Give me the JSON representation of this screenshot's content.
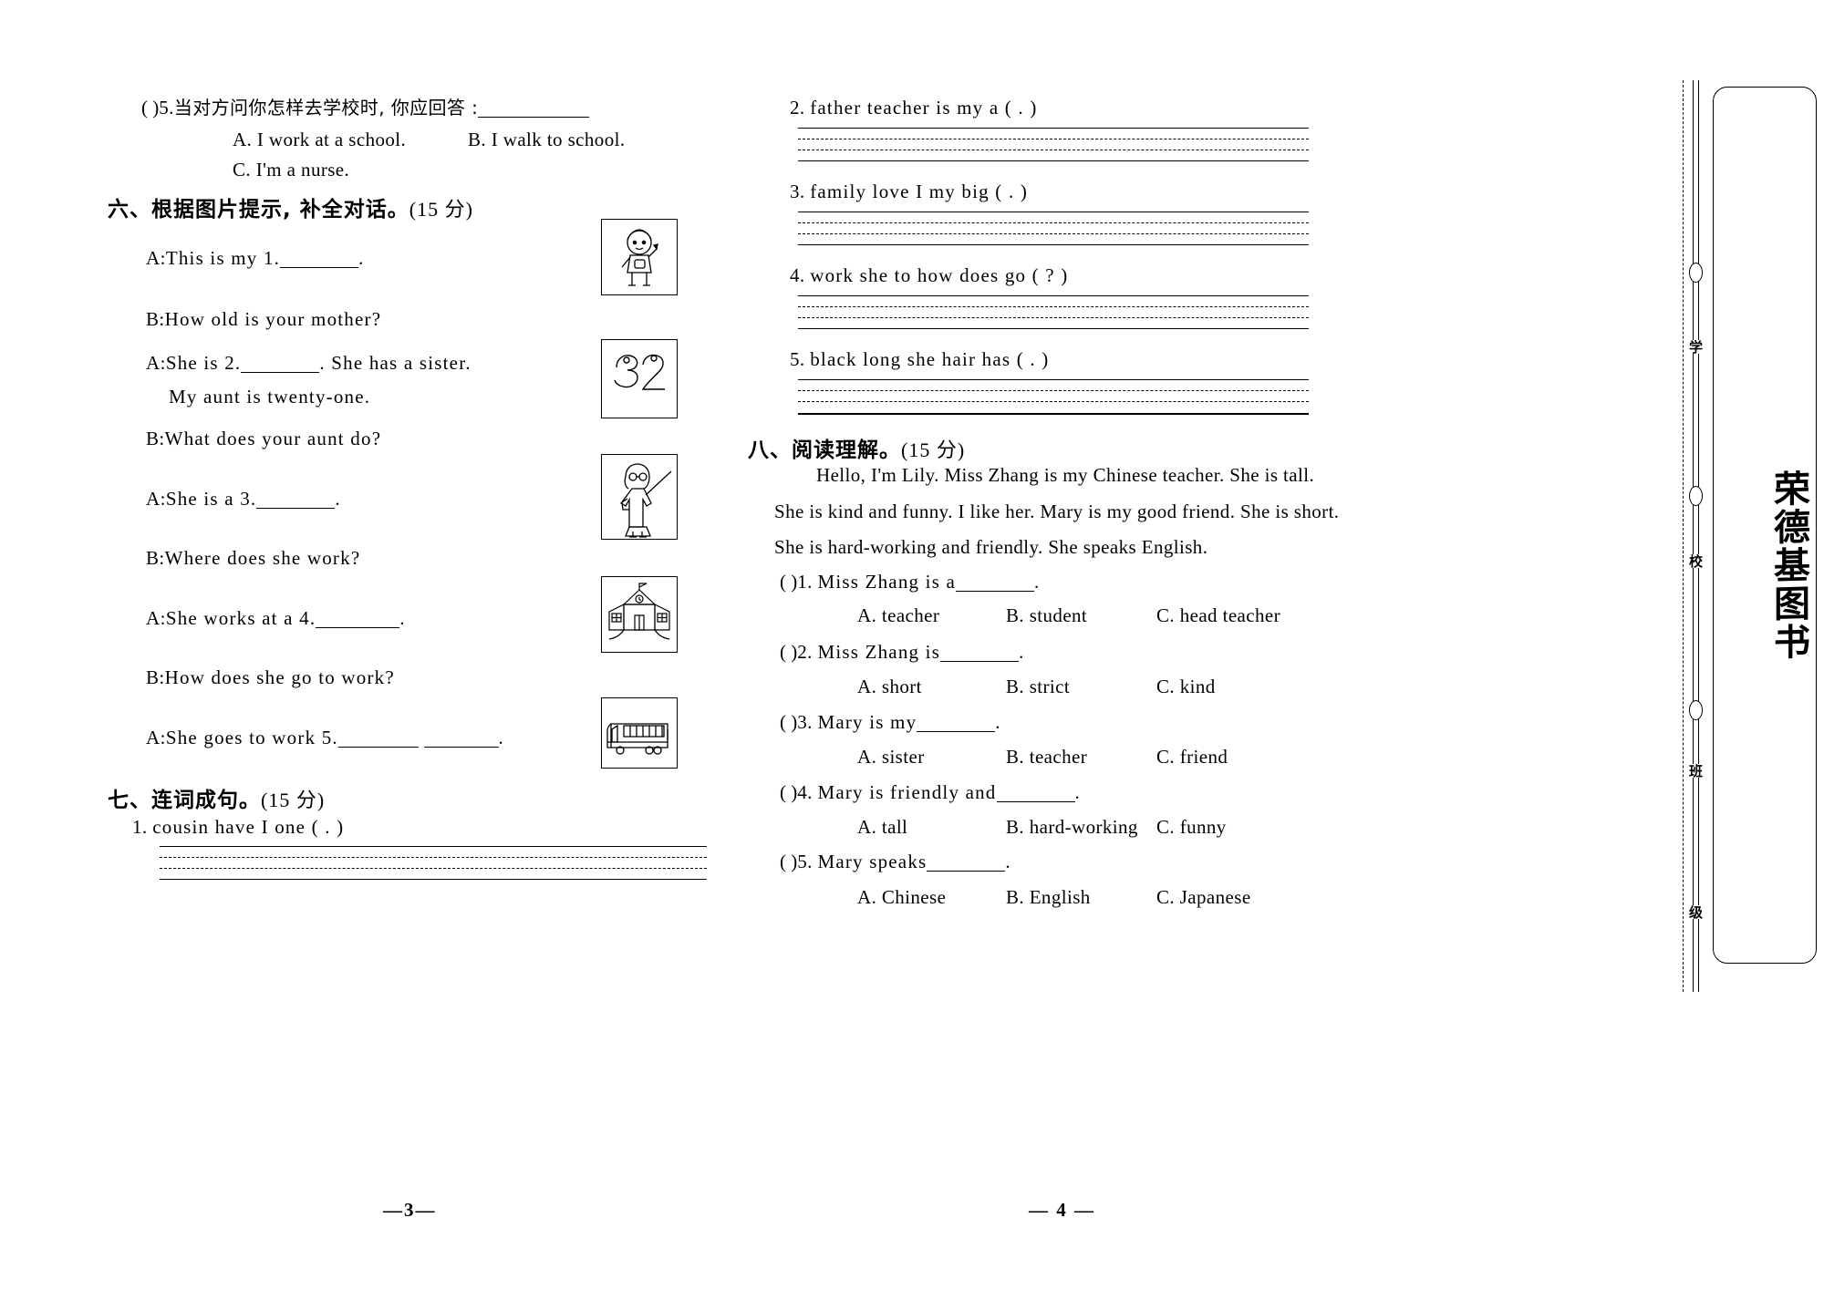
{
  "document": {
    "type": "english-exam-worksheet",
    "page_numbers": {
      "left": "—3—",
      "right": "— 4 —"
    },
    "binding_margin_chars": [
      "学",
      "校",
      "班",
      "级"
    ],
    "logo_text": "荣德基图书"
  },
  "left_column": {
    "carryover_question": {
      "paren": "(          )",
      "number": "5.",
      "prompt": "当对方问你怎样去学校时, 你应回答 :",
      "blank": "",
      "options": [
        {
          "label": "A. I work at a school."
        },
        {
          "label": "B. I walk to school."
        },
        {
          "label": "C. I'm a nurse."
        }
      ]
    },
    "section_six": {
      "heading": "六、根据图片提示, 补全对话。",
      "points": "(15 分)",
      "dialogue": [
        {
          "speaker": "A",
          "sep": ":",
          "pre": "This is my 1.",
          "post": "."
        },
        {
          "speaker": "B",
          "sep": ":",
          "pre": "How old is your mother?",
          "post": ""
        },
        {
          "speaker": "A",
          "sep": ":",
          "pre": "She is 2.",
          "post": ". She has a sister."
        },
        {
          "speaker": "",
          "sep": "",
          "pre": "My aunt is twenty-one.",
          "post": ""
        },
        {
          "speaker": "B",
          "sep": ":",
          "pre": "What does your aunt do?",
          "post": ""
        },
        {
          "speaker": "A",
          "sep": ":",
          "pre": "She is a 3.",
          "post": "."
        },
        {
          "speaker": "B",
          "sep": ":",
          "pre": "Where does she work?",
          "post": ""
        },
        {
          "speaker": "A",
          "sep": ":",
          "pre": "She works at a 4.",
          "post": "."
        },
        {
          "speaker": "B",
          "sep": ":",
          "pre": "How does she go to work?",
          "post": ""
        },
        {
          "speaker": "A",
          "sep": ":",
          "pre": "She goes to work 5.",
          "post": "."
        }
      ],
      "picture_boxes": [
        {
          "name": "child-holding-flower",
          "icon": "girl-with-item"
        },
        {
          "name": "number-32",
          "icon": "number-32",
          "label": "32"
        },
        {
          "name": "teacher-with-pointer",
          "icon": "teacher"
        },
        {
          "name": "school-building",
          "icon": "school"
        },
        {
          "name": "bus",
          "icon": "bus"
        }
      ]
    },
    "section_seven": {
      "heading": "七、连词成句。",
      "points": "(15 分)",
      "items": [
        {
          "number": "1.",
          "words": "cousin   have   I   one   ( . )"
        }
      ]
    }
  },
  "right_column": {
    "section_seven_continued": {
      "items": [
        {
          "number": "2.",
          "words": "father    teacher    is    my    a    ( . )"
        },
        {
          "number": "3.",
          "words": "family    love    I    my    big    ( . )"
        },
        {
          "number": "4.",
          "words": "work    she    to    how    does    go    ( ? )"
        },
        {
          "number": "5.",
          "words": "black    long    she    hair    has    ( . )"
        }
      ]
    },
    "section_eight": {
      "heading": "八、阅读理解。",
      "points": "(15 分)",
      "passage": [
        "Hello, I'm Lily. Miss Zhang is my Chinese teacher. She is tall.",
        "She is kind and funny. I like her. Mary is my good friend. She is short.",
        "She is hard-working and friendly. She speaks English."
      ],
      "questions": [
        {
          "paren": "(        )",
          "number": "1.",
          "stem_pre": "Miss Zhang is a",
          "stem_post": ".",
          "options": [
            "A. teacher",
            "B. student",
            "C. head teacher"
          ]
        },
        {
          "paren": "(        )",
          "number": "2.",
          "stem_pre": "Miss Zhang is",
          "stem_post": ".",
          "options": [
            "A. short",
            "B. strict",
            "C. kind"
          ]
        },
        {
          "paren": "(        )",
          "number": "3.",
          "stem_pre": "Mary is my",
          "stem_post": ".",
          "options": [
            "A. sister",
            "B. teacher",
            "C. friend"
          ]
        },
        {
          "paren": "(        )",
          "number": "4.",
          "stem_pre": "Mary is friendly and",
          "stem_post": ".",
          "options": [
            "A. tall",
            "B. hard-working",
            "C. funny"
          ]
        },
        {
          "paren": "(        )",
          "number": "5.",
          "stem_pre": "Mary speaks",
          "stem_post": ".",
          "options": [
            "A. Chinese",
            "B. English",
            "C. Japanese"
          ]
        }
      ]
    }
  }
}
